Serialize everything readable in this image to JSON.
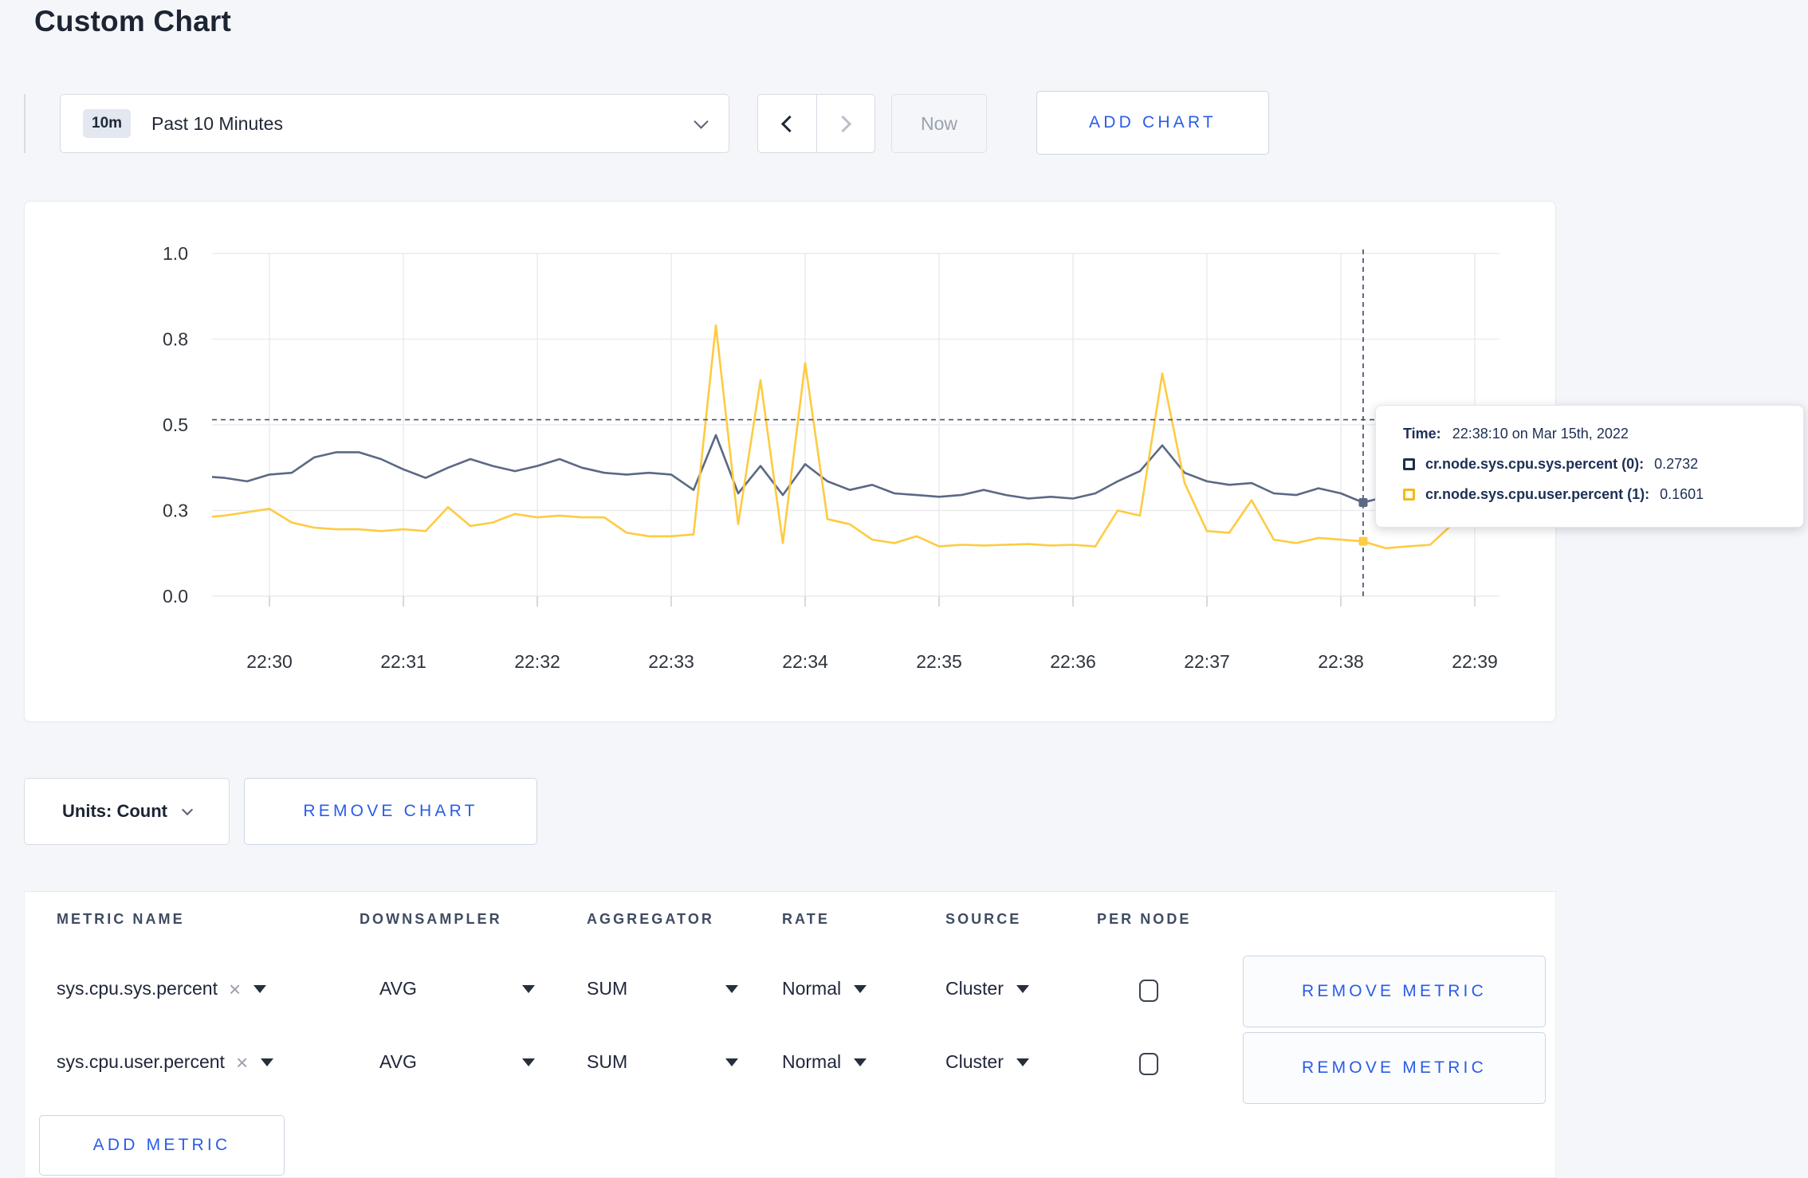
{
  "page": {
    "title": "Custom Chart"
  },
  "toolbar": {
    "range_badge": "10m",
    "range_label": "Past 10 Minutes",
    "now_label": "Now",
    "add_chart_label": "ADD CHART"
  },
  "chart": {
    "tooltip": {
      "time_label": "Time:",
      "time_value": "22:38:10 on Mar 15th, 2022",
      "series": [
        {
          "name": "cr.node.sys.cpu.sys.percent (0):",
          "value": "0.2732",
          "color": "#1f2d4d"
        },
        {
          "name": "cr.node.sys.cpu.user.percent (1):",
          "value": "0.1601",
          "color": "#f2ba1a"
        }
      ]
    }
  },
  "chart_data": {
    "type": "line",
    "title": "",
    "xlabel": "",
    "ylabel": "",
    "grid": true,
    "legend_position": "none",
    "ylim": [
      0,
      1
    ],
    "yticks": [
      {
        "value": 0,
        "label": "0.0"
      },
      {
        "value": 0.25,
        "label": "0.3"
      },
      {
        "value": 0.5,
        "label": "0.5"
      },
      {
        "value": 0.75,
        "label": "0.8"
      },
      {
        "value": 1,
        "label": "1.0"
      }
    ],
    "xticks": [
      "22:30",
      "22:31",
      "22:32",
      "22:33",
      "22:34",
      "22:35",
      "22:36",
      "22:37",
      "22:38",
      "22:39"
    ],
    "x": [
      "22:29:30",
      "22:29:40",
      "22:29:50",
      "22:30:00",
      "22:30:10",
      "22:30:20",
      "22:30:30",
      "22:30:40",
      "22:30:50",
      "22:31:00",
      "22:31:10",
      "22:31:20",
      "22:31:30",
      "22:31:40",
      "22:31:50",
      "22:32:00",
      "22:32:10",
      "22:32:20",
      "22:32:30",
      "22:32:40",
      "22:32:50",
      "22:33:00",
      "22:33:10",
      "22:33:20",
      "22:33:30",
      "22:33:40",
      "22:33:50",
      "22:34:00",
      "22:34:10",
      "22:34:20",
      "22:34:30",
      "22:34:40",
      "22:34:50",
      "22:35:00",
      "22:35:10",
      "22:35:20",
      "22:35:30",
      "22:35:40",
      "22:35:50",
      "22:36:00",
      "22:36:10",
      "22:36:20",
      "22:36:30",
      "22:36:40",
      "22:36:50",
      "22:37:00",
      "22:37:10",
      "22:37:20",
      "22:37:30",
      "22:37:40",
      "22:37:50",
      "22:38:00",
      "22:38:10",
      "22:38:20",
      "22:38:30",
      "22:38:40",
      "22:38:50",
      "22:39:00",
      "22:39:10"
    ],
    "series": [
      {
        "name": "cr.node.sys.cpu.sys.percent",
        "color": "#5b6984",
        "values": [
          0.35,
          0.345,
          0.335,
          0.355,
          0.36,
          0.405,
          0.42,
          0.42,
          0.4,
          0.37,
          0.345,
          0.375,
          0.4,
          0.38,
          0.365,
          0.38,
          0.4,
          0.375,
          0.36,
          0.355,
          0.36,
          0.355,
          0.31,
          0.47,
          0.3,
          0.38,
          0.295,
          0.385,
          0.335,
          0.31,
          0.325,
          0.3,
          0.295,
          0.29,
          0.295,
          0.31,
          0.295,
          0.285,
          0.29,
          0.285,
          0.3,
          0.335,
          0.365,
          0.44,
          0.36,
          0.335,
          0.325,
          0.33,
          0.3,
          0.295,
          0.315,
          0.3,
          0.2732,
          0.29,
          0.3,
          0.305,
          0.3,
          0.31,
          0.3
        ]
      },
      {
        "name": "cr.node.sys.cpu.user.percent",
        "color": "#fecb41",
        "values": [
          0.23,
          0.235,
          0.245,
          0.255,
          0.215,
          0.2,
          0.195,
          0.195,
          0.19,
          0.195,
          0.19,
          0.26,
          0.205,
          0.215,
          0.24,
          0.23,
          0.235,
          0.23,
          0.23,
          0.185,
          0.175,
          0.175,
          0.18,
          0.79,
          0.21,
          0.63,
          0.155,
          0.68,
          0.225,
          0.21,
          0.165,
          0.155,
          0.175,
          0.145,
          0.15,
          0.148,
          0.15,
          0.152,
          0.148,
          0.15,
          0.145,
          0.25,
          0.235,
          0.65,
          0.33,
          0.19,
          0.185,
          0.28,
          0.165,
          0.155,
          0.17,
          0.165,
          0.1601,
          0.14,
          0.145,
          0.15,
          0.21,
          0.285,
          0.235
        ]
      }
    ],
    "crosshair": {
      "x": "22:38:10",
      "y_value": 0.515
    },
    "highlight": {
      "x": "22:38:10",
      "values": [
        0.2732,
        0.1601
      ]
    }
  },
  "controls": {
    "units_label": "Units: Count",
    "remove_chart_label": "REMOVE CHART"
  },
  "metrics_table": {
    "headers": [
      "METRIC NAME",
      "DOWNSAMPLER",
      "AGGREGATOR",
      "RATE",
      "SOURCE",
      "PER NODE"
    ],
    "rows": [
      {
        "metric": "sys.cpu.sys.percent",
        "downsampler": "AVG",
        "aggregator": "SUM",
        "rate": "Normal",
        "source": "Cluster",
        "per_node_checked": false,
        "remove_label": "REMOVE METRIC"
      },
      {
        "metric": "sys.cpu.user.percent",
        "downsampler": "AVG",
        "aggregator": "SUM",
        "rate": "Normal",
        "source": "Cluster",
        "per_node_checked": false,
        "remove_label": "REMOVE METRIC"
      }
    ],
    "add_metric_label": "ADD METRIC"
  }
}
